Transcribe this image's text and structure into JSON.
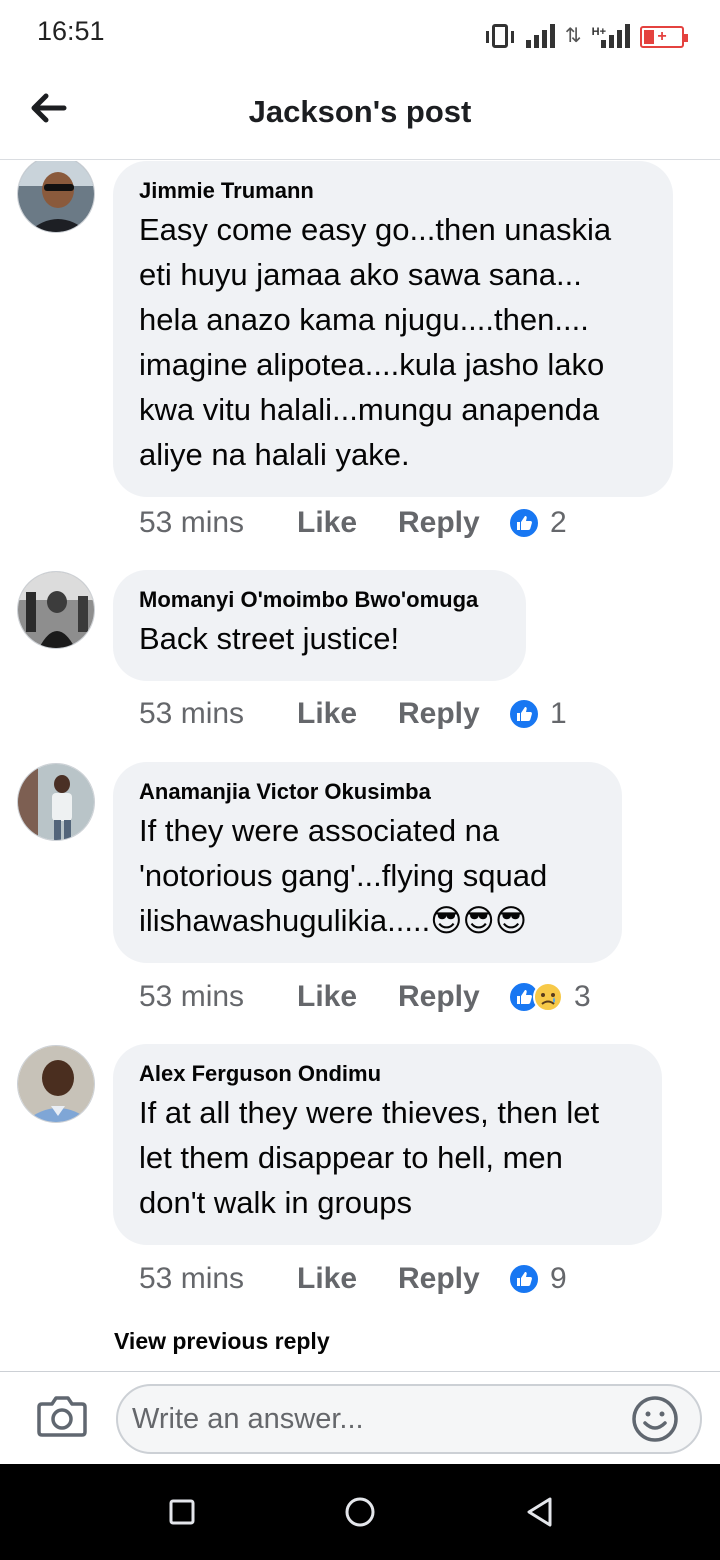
{
  "status_bar": {
    "time": "16:51",
    "network_label": "H+",
    "icons": [
      "vibrate-icon",
      "signal-icon",
      "data-arrows-icon",
      "signal-h-plus-icon",
      "battery-charging-icon"
    ]
  },
  "header": {
    "title": "Jackson's post",
    "back_icon": "arrow-left-icon"
  },
  "comments": [
    {
      "author": "Jimmie Trumann",
      "text": "Easy come easy go...then unaskia\neti huyu jamaa ako sawa sana...\nhela anazo kama njugu....then....\nimagine alipotea....kula jasho lako\nkwa vitu halali...mungu anapenda\naliye na halali yake.",
      "time": "53 mins",
      "like_label": "Like",
      "reply_label": "Reply",
      "reactions": [
        "like"
      ],
      "reaction_count": "2"
    },
    {
      "author": "Momanyi O'moimbo Bwo'omuga",
      "text": "Back street justice!",
      "time": "53 mins",
      "like_label": "Like",
      "reply_label": "Reply",
      "reactions": [
        "like"
      ],
      "reaction_count": "1"
    },
    {
      "author": "Anamanjia Victor Okusimba",
      "text": "If they were associated na\n'notorious gang'...flying squad\nilishawashugulikia.....",
      "emojis": [
        "😎",
        "😎",
        "😎"
      ],
      "time": "53 mins",
      "like_label": "Like",
      "reply_label": "Reply",
      "reactions": [
        "like",
        "sad"
      ],
      "reaction_count": "3"
    },
    {
      "author": "Alex Ferguson Ondimu",
      "text": "If at all they were thieves, then let\nlet them disappear to hell, men\ndon't walk in groups",
      "time": "53 mins",
      "like_label": "Like",
      "reply_label": "Reply",
      "reactions": [
        "like"
      ],
      "reaction_count": "9"
    }
  ],
  "view_previous": "View previous reply",
  "composer": {
    "placeholder": "Write an answer...",
    "camera_icon": "camera-icon",
    "emoji_icon": "smiley-icon"
  },
  "nav_bar": {
    "icons": [
      "recent-apps-icon",
      "home-icon",
      "back-triangle-icon"
    ]
  },
  "colors": {
    "accent": "#1877f2",
    "bubble": "#f0f2f5",
    "secondary_text": "#65676b",
    "battery": "#e4423f"
  }
}
